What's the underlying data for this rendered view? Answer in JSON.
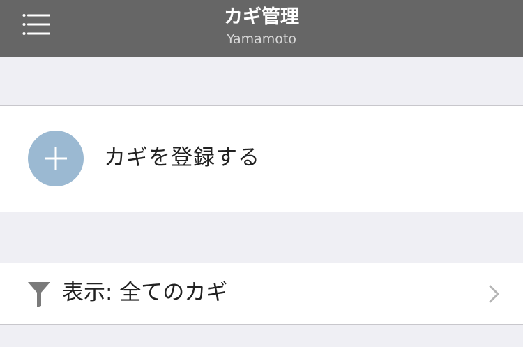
{
  "header": {
    "title": "カギ管理",
    "subtitle": "Yamamoto",
    "menu_icon": "hamburger-menu-icon",
    "background_color": "#666666"
  },
  "register_row": {
    "label": "カギを登録する",
    "icon": "plus-icon",
    "icon_color": "#9bb9d2"
  },
  "filter_row": {
    "label": "表示: 全てのカギ",
    "icon": "filter-funnel-icon",
    "trailing_icon": "chevron-right-icon"
  },
  "colors": {
    "page_background": "#efeff4",
    "row_background": "#ffffff",
    "separator": "#c8c7cc"
  }
}
